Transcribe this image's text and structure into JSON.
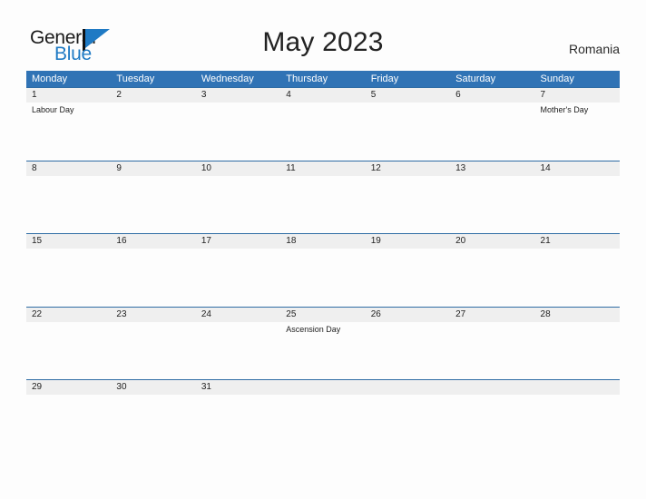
{
  "brand": {
    "name_part1": "General",
    "name_part2": "Blue",
    "flag_color": "#1f7ac4",
    "text_color": "#1b1b1b"
  },
  "header": {
    "title": "May 2023",
    "country": "Romania",
    "accent_color": "#3073b5",
    "band_color": "#efefef"
  },
  "calendar": {
    "weekdays": [
      "Monday",
      "Tuesday",
      "Wednesday",
      "Thursday",
      "Friday",
      "Saturday",
      "Sunday"
    ],
    "weeks": [
      [
        {
          "date": "1",
          "events": [
            "Labour Day"
          ]
        },
        {
          "date": "2",
          "events": []
        },
        {
          "date": "3",
          "events": []
        },
        {
          "date": "4",
          "events": []
        },
        {
          "date": "5",
          "events": []
        },
        {
          "date": "6",
          "events": []
        },
        {
          "date": "7",
          "events": [
            "Mother's Day"
          ]
        }
      ],
      [
        {
          "date": "8",
          "events": []
        },
        {
          "date": "9",
          "events": []
        },
        {
          "date": "10",
          "events": []
        },
        {
          "date": "11",
          "events": []
        },
        {
          "date": "12",
          "events": []
        },
        {
          "date": "13",
          "events": []
        },
        {
          "date": "14",
          "events": []
        }
      ],
      [
        {
          "date": "15",
          "events": []
        },
        {
          "date": "16",
          "events": []
        },
        {
          "date": "17",
          "events": []
        },
        {
          "date": "18",
          "events": []
        },
        {
          "date": "19",
          "events": []
        },
        {
          "date": "20",
          "events": []
        },
        {
          "date": "21",
          "events": []
        }
      ],
      [
        {
          "date": "22",
          "events": []
        },
        {
          "date": "23",
          "events": []
        },
        {
          "date": "24",
          "events": []
        },
        {
          "date": "25",
          "events": [
            "Ascension Day"
          ]
        },
        {
          "date": "26",
          "events": []
        },
        {
          "date": "27",
          "events": []
        },
        {
          "date": "28",
          "events": []
        }
      ],
      [
        {
          "date": "29",
          "events": []
        },
        {
          "date": "30",
          "events": []
        },
        {
          "date": "31",
          "events": []
        },
        {
          "date": "",
          "events": []
        },
        {
          "date": "",
          "events": []
        },
        {
          "date": "",
          "events": []
        },
        {
          "date": "",
          "events": []
        }
      ]
    ]
  }
}
